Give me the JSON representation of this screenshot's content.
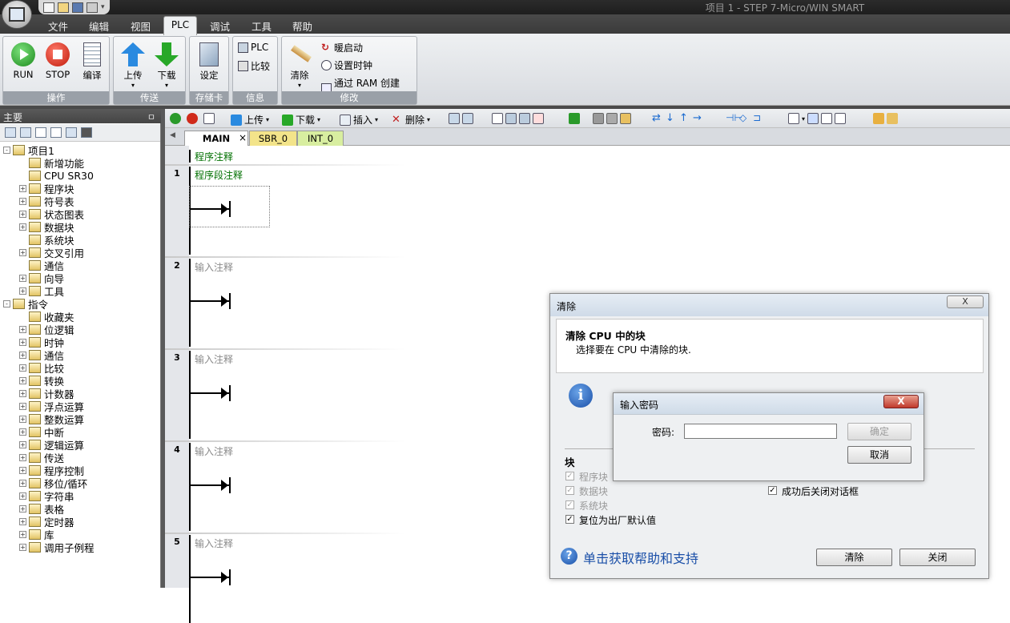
{
  "window": {
    "title": "项目 1 - STEP 7-Micro/WIN SMART"
  },
  "menu": {
    "items": [
      "文件",
      "编辑",
      "视图",
      "PLC",
      "调试",
      "工具",
      "帮助"
    ],
    "active": "PLC"
  },
  "ribbon": {
    "groups": [
      {
        "label": "操作",
        "buttons": [
          "RUN",
          "STOP",
          "编译"
        ]
      },
      {
        "label": "传送",
        "buttons": [
          "上传",
          "下载"
        ]
      },
      {
        "label": "存储卡",
        "buttons": [
          "设定"
        ]
      },
      {
        "label": "信息",
        "buttons": [
          "PLC",
          "比较"
        ]
      },
      {
        "label": "修改",
        "buttons": [
          "清除",
          "暖启动",
          "设置时钟",
          "通过 RAM 创建 DB"
        ]
      }
    ]
  },
  "left_panel": {
    "title": "主要",
    "pin": "ㅁ",
    "tree": [
      {
        "label": "项目1",
        "level": 0,
        "exp": "-"
      },
      {
        "label": "新增功能",
        "level": 1,
        "exp": ""
      },
      {
        "label": "CPU SR30",
        "level": 1,
        "exp": ""
      },
      {
        "label": "程序块",
        "level": 1,
        "exp": "+"
      },
      {
        "label": "符号表",
        "level": 1,
        "exp": "+"
      },
      {
        "label": "状态图表",
        "level": 1,
        "exp": "+"
      },
      {
        "label": "数据块",
        "level": 1,
        "exp": "+"
      },
      {
        "label": "系统块",
        "level": 1,
        "exp": ""
      },
      {
        "label": "交叉引用",
        "level": 1,
        "exp": "+"
      },
      {
        "label": "通信",
        "level": 1,
        "exp": ""
      },
      {
        "label": "向导",
        "level": 1,
        "exp": "+"
      },
      {
        "label": "工具",
        "level": 1,
        "exp": "+"
      },
      {
        "label": "指令",
        "level": 0,
        "exp": "-"
      },
      {
        "label": "收藏夹",
        "level": 1,
        "exp": ""
      },
      {
        "label": "位逻辑",
        "level": 1,
        "exp": "+"
      },
      {
        "label": "时钟",
        "level": 1,
        "exp": "+"
      },
      {
        "label": "通信",
        "level": 1,
        "exp": "+"
      },
      {
        "label": "比较",
        "level": 1,
        "exp": "+"
      },
      {
        "label": "转换",
        "level": 1,
        "exp": "+"
      },
      {
        "label": "计数器",
        "level": 1,
        "exp": "+"
      },
      {
        "label": "浮点运算",
        "level": 1,
        "exp": "+"
      },
      {
        "label": "整数运算",
        "level": 1,
        "exp": "+"
      },
      {
        "label": "中断",
        "level": 1,
        "exp": "+"
      },
      {
        "label": "逻辑运算",
        "level": 1,
        "exp": "+"
      },
      {
        "label": "传送",
        "level": 1,
        "exp": "+"
      },
      {
        "label": "程序控制",
        "level": 1,
        "exp": "+"
      },
      {
        "label": "移位/循环",
        "level": 1,
        "exp": "+"
      },
      {
        "label": "字符串",
        "level": 1,
        "exp": "+"
      },
      {
        "label": "表格",
        "level": 1,
        "exp": "+"
      },
      {
        "label": "定时器",
        "level": 1,
        "exp": "+"
      },
      {
        "label": "库",
        "level": 1,
        "exp": "+"
      },
      {
        "label": "调用子例程",
        "level": 1,
        "exp": "+"
      }
    ]
  },
  "editor_toolbar": {
    "upload": "上传",
    "download": "下载",
    "insert": "插入",
    "delete": "删除"
  },
  "tabs": [
    {
      "label": "MAIN",
      "active": true,
      "close": "×"
    },
    {
      "label": "SBR_0",
      "active": false
    },
    {
      "label": "INT_0",
      "active": false
    }
  ],
  "ladder": {
    "program_comment": "程序注释",
    "rungs": [
      {
        "num": "1",
        "comment": "程序段注释"
      },
      {
        "num": "2",
        "comment": "输入注释"
      },
      {
        "num": "3",
        "comment": "输入注释"
      },
      {
        "num": "4",
        "comment": "输入注释"
      },
      {
        "num": "5",
        "comment": "输入注释"
      }
    ]
  },
  "clear_dialog": {
    "title": "清除",
    "close": "X",
    "heading": "清除 CPU 中的块",
    "subtitle": "选择要在 CPU 中清除的块.",
    "section": "块",
    "options": [
      {
        "label": "程序块",
        "checked": true,
        "disabled": true
      },
      {
        "label": "数据块",
        "checked": true,
        "disabled": true
      },
      {
        "label": "系统块",
        "checked": true,
        "disabled": true
      },
      {
        "label": "复位为出厂默认值",
        "checked": true,
        "disabled": false
      }
    ],
    "close_after": {
      "label": "成功后关闭对话框",
      "checked": true
    },
    "help_link": "单击获取帮助和支持",
    "clear_button": "清除",
    "close_button": "关闭"
  },
  "password_dialog": {
    "title": "输入密码",
    "close": "X",
    "label": "密码:",
    "value": "",
    "ok_button": "确定",
    "cancel_button": "取消"
  },
  "colors": {
    "accent_green": "#2a8a2a",
    "help_blue": "#1a4fa8",
    "comment_green": "#007000"
  }
}
